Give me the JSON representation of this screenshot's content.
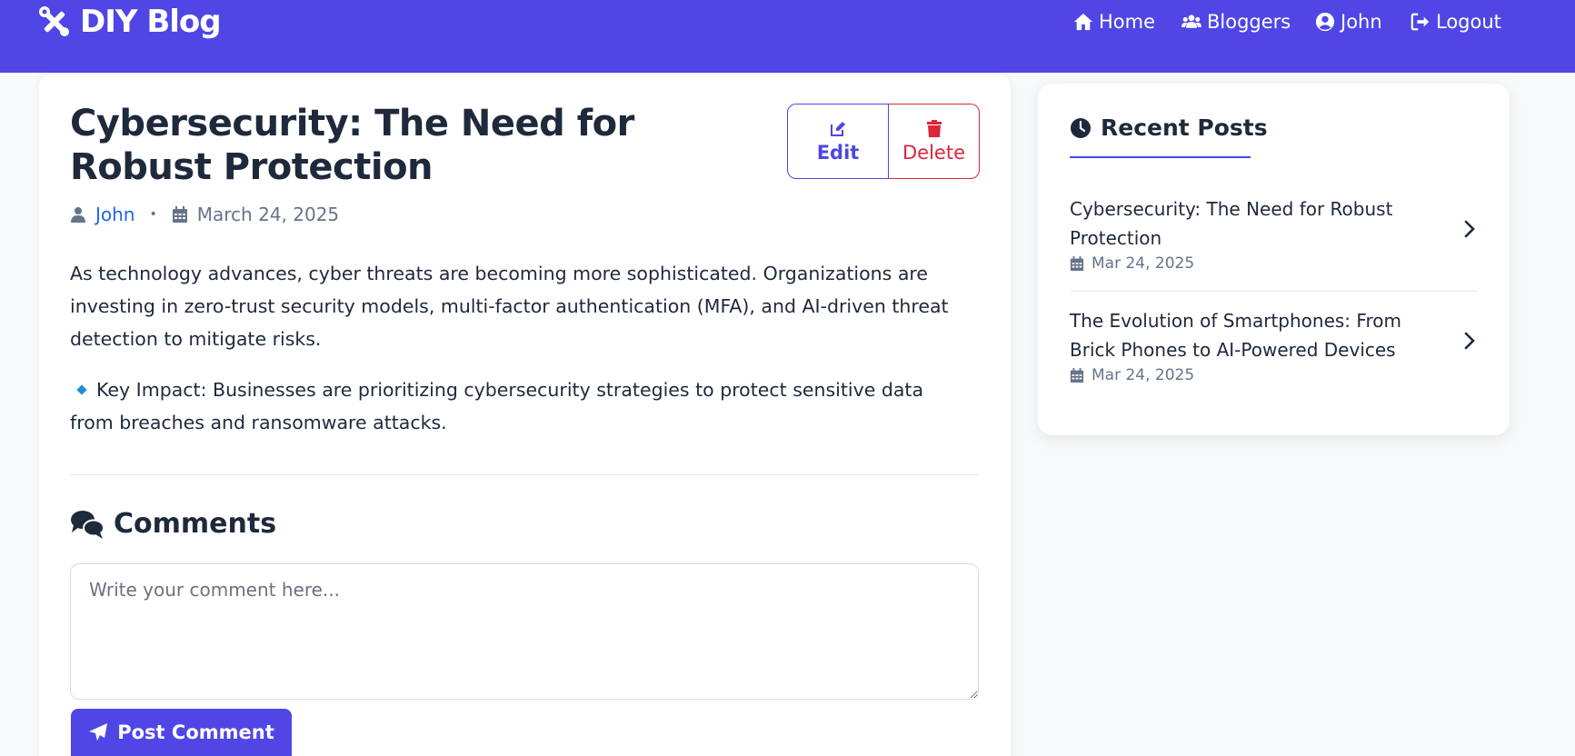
{
  "nav": {
    "brand": "DIY Blog",
    "links": [
      {
        "label": "Home",
        "icon": "home-icon"
      },
      {
        "label": "Bloggers",
        "icon": "users-icon"
      },
      {
        "label": "John",
        "icon": "user-circle-icon"
      },
      {
        "label": "Logout",
        "icon": "logout-icon"
      }
    ]
  },
  "post": {
    "title": "Cybersecurity: The Need for Robust Protection",
    "author": "John",
    "date": "March 24, 2025",
    "edit_label": "Edit",
    "delete_label": "Delete",
    "paragraph1": "As technology advances, cyber threats are becoming more sophisticated. Organizations are investing in zero-trust security models, multi-factor authentication (MFA), and AI-driven threat detection to mitigate risks.",
    "paragraph2": "Key Impact: Businesses are prioritizing cybersecurity strategies to protect sensitive data from breaches and ransomware attacks."
  },
  "comments": {
    "heading": "Comments",
    "placeholder": "Write your comment here...",
    "submit_label": "Post Comment"
  },
  "sidebar": {
    "heading": "Recent Posts",
    "items": [
      {
        "title": "Cybersecurity: The Need for Robust Protection",
        "date": "Mar 24, 2025"
      },
      {
        "title": "The Evolution of Smartphones: From Brick Phones to AI-Powered Devices",
        "date": "Mar 24, 2025"
      }
    ]
  },
  "colors": {
    "primary": "#4f46e5",
    "danger": "#dc2638",
    "link": "#2563eb",
    "muted": "#64748b",
    "text": "#1e293b",
    "bullet": "#1d8fd6"
  }
}
